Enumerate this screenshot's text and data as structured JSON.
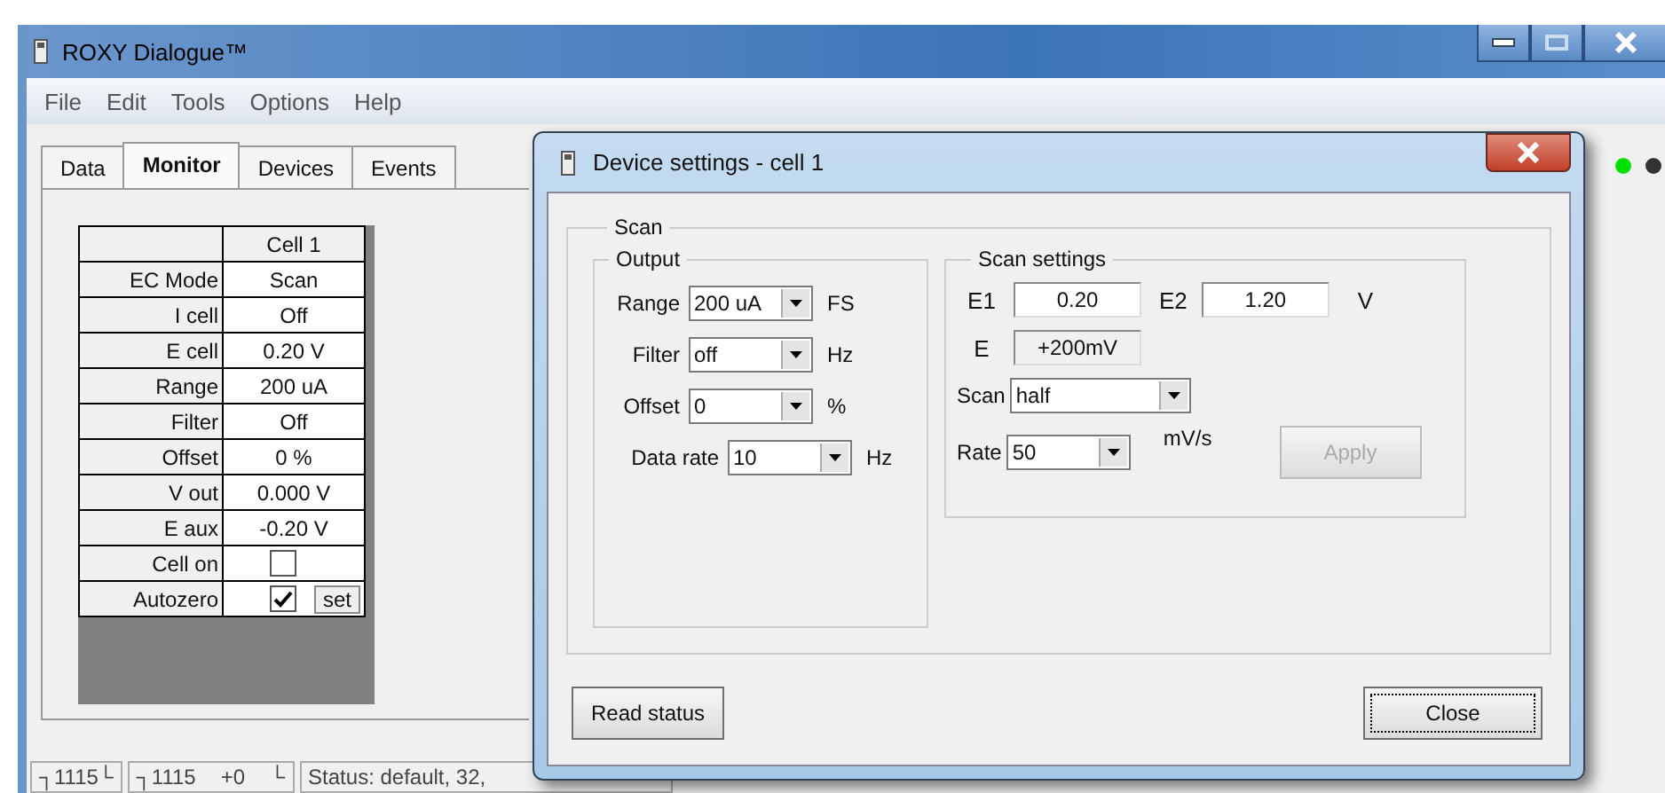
{
  "window": {
    "title": "ROXY Dialogue™",
    "menu": [
      "File",
      "Edit",
      "Tools",
      "Options",
      "Help"
    ],
    "tabs": [
      {
        "label": "Data",
        "selected": false
      },
      {
        "label": "Monitor",
        "selected": true
      },
      {
        "label": "Devices",
        "selected": false
      },
      {
        "label": "Events",
        "selected": false
      }
    ],
    "status_indicators": [
      {
        "color": "#00e000"
      },
      {
        "color": "#333333"
      }
    ],
    "cell_table": {
      "header": "Cell 1",
      "rows": [
        {
          "label": "EC Mode",
          "kind": "text",
          "value": "Scan"
        },
        {
          "label": "I cell",
          "kind": "text",
          "value": "Off"
        },
        {
          "label": "E cell",
          "kind": "text",
          "value": "0.20 V"
        },
        {
          "label": "Range",
          "kind": "text",
          "value": "200 uA"
        },
        {
          "label": "Filter",
          "kind": "text",
          "value": "Off"
        },
        {
          "label": "Offset",
          "kind": "text",
          "value": "0 %"
        },
        {
          "label": "V out",
          "kind": "text",
          "value": "0.000 V"
        },
        {
          "label": "E aux",
          "kind": "text",
          "value": "-0.20 V"
        },
        {
          "label": "Cell on",
          "kind": "checkbox",
          "checked": false
        },
        {
          "label": "Autozero",
          "kind": "checkbox",
          "checked": true,
          "button": "set"
        }
      ]
    },
    "status_bar": [
      {
        "texts": [
          "┐1115└"
        ]
      },
      {
        "texts": [
          "┐1115",
          "+0",
          "└"
        ]
      },
      {
        "texts": [
          "Status: default, 32,"
        ]
      }
    ]
  },
  "dialog": {
    "title": "Device settings - cell 1",
    "group": "Scan",
    "output": {
      "title": "Output",
      "fields": [
        {
          "label": "Range",
          "value": "200 uA",
          "unit": "FS"
        },
        {
          "label": "Filter",
          "value": "off",
          "unit": "Hz"
        },
        {
          "label": "Offset",
          "value": "0",
          "unit": "%"
        },
        {
          "label": "Data rate",
          "value": "10",
          "unit": "Hz"
        }
      ]
    },
    "scan_settings": {
      "title": "Scan settings",
      "e1": {
        "label": "E1",
        "value": "0.20"
      },
      "e2": {
        "label": "E2",
        "value": "1.20"
      },
      "unit": "V",
      "e": {
        "label": "E",
        "value": "+200mV"
      },
      "scan": {
        "label": "Scan",
        "value": "half"
      },
      "rate": {
        "label": "Rate",
        "value": "50",
        "unit": "mV/s"
      },
      "apply": {
        "label": "Apply",
        "disabled": true
      }
    },
    "read_status": "Read status",
    "close": "Close"
  }
}
